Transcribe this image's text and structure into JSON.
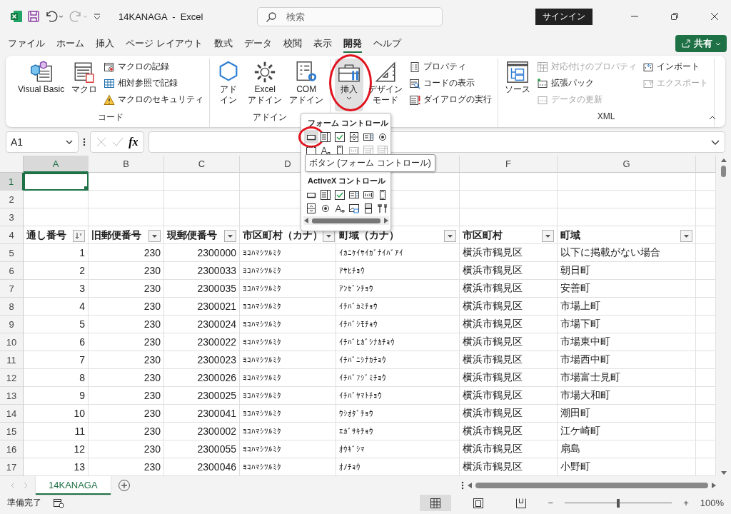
{
  "title_bar": {
    "document": "14KANAGA  -  Excel",
    "search_placeholder": "検索",
    "sign_in": "サインイン"
  },
  "menu_tabs": [
    {
      "label": "ファイル",
      "selected": false
    },
    {
      "label": "ホーム",
      "selected": false
    },
    {
      "label": "挿入",
      "selected": false
    },
    {
      "label": "ページ レイアウト",
      "selected": false
    },
    {
      "label": "数式",
      "selected": false
    },
    {
      "label": "データ",
      "selected": false
    },
    {
      "label": "校閲",
      "selected": false
    },
    {
      "label": "表示",
      "selected": false
    },
    {
      "label": "開発",
      "selected": true
    },
    {
      "label": "ヘルプ",
      "selected": false
    }
  ],
  "share_button": "共有",
  "ribbon": {
    "groups": [
      {
        "label": "コード",
        "items": [
          {
            "kind": "large",
            "lines": [
              "Visual Basic"
            ],
            "pressed": false
          },
          {
            "kind": "large",
            "lines": [
              "マクロ"
            ],
            "pressed": false
          },
          {
            "kind": "stack",
            "items": [
              {
                "label": "マクロの記録",
                "disabled": false
              },
              {
                "label": "相対参照で記録",
                "disabled": false
              },
              {
                "label": "マクロのセキュリティ",
                "disabled": false
              }
            ]
          }
        ]
      },
      {
        "label": "アドイン",
        "items": [
          {
            "kind": "large",
            "lines": [
              "アド",
              "イン"
            ],
            "pressed": false
          },
          {
            "kind": "large",
            "lines": [
              "Excel",
              "アドイン"
            ],
            "pressed": false
          },
          {
            "kind": "large",
            "lines": [
              "COM",
              "アドイン"
            ],
            "pressed": false
          }
        ]
      },
      {
        "items": [
          {
            "kind": "large",
            "lines": [
              "挿入"
            ],
            "pressed": true,
            "circled": true,
            "caret": true
          },
          {
            "kind": "large",
            "lines": [
              "デザイン",
              "モード"
            ],
            "pressed": false
          },
          {
            "kind": "stack",
            "items": [
              {
                "label": "プロパティ",
                "disabled": false
              },
              {
                "label": "コードの表示",
                "disabled": false
              },
              {
                "label": "ダイアログの実行",
                "disabled": false
              }
            ]
          }
        ]
      },
      {
        "label": "XML",
        "items": [
          {
            "kind": "large",
            "lines": [
              "ソース"
            ],
            "pressed": false
          },
          {
            "kind": "stack",
            "items": [
              {
                "label": "対応付けのプロパティ",
                "disabled": true
              },
              {
                "label": "拡張パック",
                "disabled": false
              },
              {
                "label": "データの更新",
                "disabled": true
              }
            ]
          },
          {
            "kind": "stack",
            "items": [
              {
                "label": "インポート",
                "disabled": false
              },
              {
                "label": "エクスポート",
                "disabled": true
              }
            ]
          }
        ]
      }
    ]
  },
  "formula_bar": {
    "name_box": "A1",
    "function_label": "fx"
  },
  "sheet": {
    "columns": [
      {
        "label": "A",
        "selected": true
      },
      {
        "label": "B",
        "selected": false
      },
      {
        "label": "C",
        "selected": false
      },
      {
        "label": "D",
        "selected": false
      },
      {
        "selected": false
      },
      {
        "label": "F",
        "selected": false
      },
      {
        "label": "G",
        "selected": false
      }
    ],
    "rows": [
      {
        "number": "1",
        "selected": true,
        "kind": "empty"
      },
      {
        "number": "2",
        "selected": false,
        "kind": "empty"
      },
      {
        "number": "3",
        "selected": false,
        "kind": "empty"
      },
      {
        "number": "4",
        "selected": false,
        "kind": "header",
        "cells": [
          {
            "text": "通し番号",
            "sorted": true
          },
          {
            "text": "旧郵便番号",
            "sorted": false
          },
          {
            "text": "現郵便番号",
            "sorted": false
          },
          {
            "text": "市区町村（カナ）",
            "sorted": false
          },
          {
            "text": "町域（カナ）",
            "sorted": false
          },
          {
            "text": "市区町村",
            "sorted": false
          },
          {
            "text": "町域",
            "sorted": false
          }
        ]
      },
      {
        "number": "5",
        "selected": false,
        "kind": "data",
        "cells": [
          "1",
          "230",
          "2300000",
          "ﾖｺﾊﾏｼﾂﾙﾐｸ",
          "ｲｶﾆｹｲｻｲｶﾞﾅｲﾊﾞｱｲ",
          "横浜市鶴見区",
          "以下に掲載がない場合"
        ]
      },
      {
        "number": "6",
        "selected": false,
        "kind": "data",
        "cells": [
          "2",
          "230",
          "2300033",
          "ﾖｺﾊﾏｼﾂﾙﾐｸ",
          "ｱｻﾋﾁｮｳ",
          "横浜市鶴見区",
          "朝日町"
        ]
      },
      {
        "number": "7",
        "selected": false,
        "kind": "data",
        "cells": [
          "3",
          "230",
          "2300035",
          "ﾖｺﾊﾏｼﾂﾙﾐｸ",
          "ｱﾝｾﾞﾝﾁｮｳ",
          "横浜市鶴見区",
          "安善町"
        ]
      },
      {
        "number": "8",
        "selected": false,
        "kind": "data",
        "cells": [
          "4",
          "230",
          "2300021",
          "ﾖｺﾊﾏｼﾂﾙﾐｸ",
          "ｲﾁﾊﾞｶﾐﾁｮｳ",
          "横浜市鶴見区",
          "市場上町"
        ]
      },
      {
        "number": "9",
        "selected": false,
        "kind": "data",
        "cells": [
          "5",
          "230",
          "2300024",
          "ﾖｺﾊﾏｼﾂﾙﾐｸ",
          "ｲﾁﾊﾞｼﾓﾁｮｳ",
          "横浜市鶴見区",
          "市場下町"
        ]
      },
      {
        "number": "10",
        "selected": false,
        "kind": "data",
        "cells": [
          "6",
          "230",
          "2300022",
          "ﾖｺﾊﾏｼﾂﾙﾐｸ",
          "ｲﾁﾊﾞﾋｶﾞｼﾅｶﾁｮｳ",
          "横浜市鶴見区",
          "市場東中町"
        ]
      },
      {
        "number": "11",
        "selected": false,
        "kind": "data",
        "cells": [
          "7",
          "230",
          "2300023",
          "ﾖｺﾊﾏｼﾂﾙﾐｸ",
          "ｲﾁﾊﾞﾆｼﾅｶﾁｮｳ",
          "横浜市鶴見区",
          "市場西中町"
        ]
      },
      {
        "number": "12",
        "selected": false,
        "kind": "data",
        "cells": [
          "8",
          "230",
          "2300026",
          "ﾖｺﾊﾏｼﾂﾙﾐｸ",
          "ｲﾁﾊﾞﾌｼﾞﾐﾁｮｳ",
          "横浜市鶴見区",
          "市場富士見町"
        ]
      },
      {
        "number": "13",
        "selected": false,
        "kind": "data",
        "cells": [
          "9",
          "230",
          "2300025",
          "ﾖｺﾊﾏｼﾂﾙﾐｸ",
          "ｲﾁﾊﾞﾔﾏﾄﾁｮｳ",
          "横浜市鶴見区",
          "市場大和町"
        ]
      },
      {
        "number": "14",
        "selected": false,
        "kind": "data",
        "cells": [
          "10",
          "230",
          "2300041",
          "ﾖｺﾊﾏｼﾂﾙﾐｸ",
          "ｳｼｵﾀﾞﾁｮｳ",
          "横浜市鶴見区",
          "潮田町"
        ]
      },
      {
        "number": "15",
        "selected": false,
        "kind": "data",
        "cells": [
          "11",
          "230",
          "2300002",
          "ﾖｺﾊﾏｼﾂﾙﾐｸ",
          "ｴｶﾞｻｷﾁｮｳ",
          "横浜市鶴見区",
          "江ケ崎町"
        ]
      },
      {
        "number": "16",
        "selected": false,
        "kind": "data",
        "cells": [
          "12",
          "230",
          "2300055",
          "ﾖｺﾊﾏｼﾂﾙﾐｸ",
          "ｵｳｷﾞｼﾏ",
          "横浜市鶴見区",
          "扇島"
        ]
      },
      {
        "number": "17",
        "selected": false,
        "kind": "data",
        "cells": [
          "13",
          "230",
          "2300046",
          "ﾖｺﾊﾏｼﾂﾙﾐｸ",
          "ｵﾉﾁｮｳ",
          "横浜市鶴見区",
          "小野町"
        ]
      }
    ]
  },
  "controls_menu": {
    "form_title": "フォーム コントロール",
    "form_controls": [
      {
        "disabled": false,
        "circled": true
      },
      {
        "disabled": false
      },
      {
        "disabled": false
      },
      {
        "disabled": false
      },
      {
        "disabled": false
      },
      {
        "disabled": false
      },
      {
        "disabled": false
      },
      {
        "disabled": false
      },
      {
        "disabled": false
      },
      {
        "disabled": true
      },
      {
        "disabled": true
      },
      {
        "disabled": true
      }
    ],
    "tooltip": "ボタン (フォーム コントロール)",
    "activex_title": "ActiveX コントロール",
    "activex_controls": [
      {
        "disabled": false
      },
      {
        "disabled": false
      },
      {
        "disabled": false
      },
      {
        "disabled": false
      },
      {
        "disabled": false
      },
      {
        "disabled": false
      },
      {
        "disabled": false
      },
      {
        "disabled": false
      },
      {
        "disabled": false
      },
      {
        "disabled": false
      },
      {
        "disabled": false
      },
      {
        "disabled": false
      }
    ]
  },
  "sheet_tabs": [
    {
      "label": "14KANAGA",
      "selected": true
    }
  ],
  "status_bar": {
    "ready": "準備完了",
    "views": [
      {
        "selected": true
      },
      {
        "selected": false
      },
      {
        "selected": false
      }
    ],
    "zoom_out": "−",
    "zoom_in": "+",
    "zoom": {
      "level": 0.5,
      "reading": "100%"
    }
  }
}
